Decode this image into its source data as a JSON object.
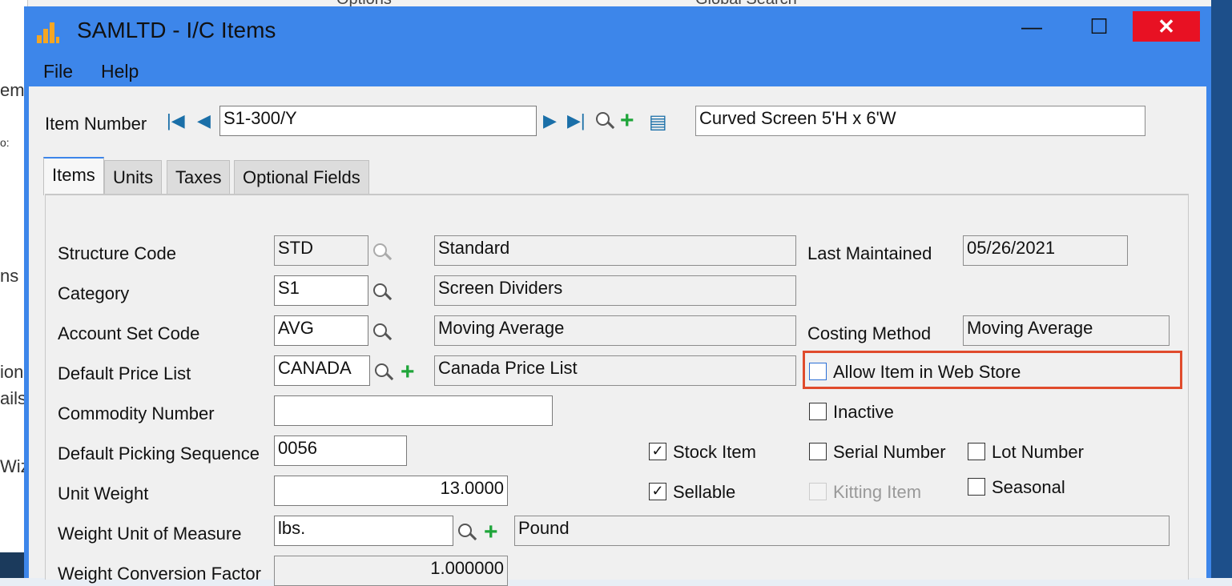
{
  "background": {
    "tab_options": "Options",
    "tab_global_search": "Global Search",
    "left_fragments": [
      "em",
      "o:",
      "ns",
      "ion",
      "ails",
      "Wiz"
    ]
  },
  "window": {
    "title": "SAMLTD - I/C Items",
    "controls": {
      "minimize": "—",
      "maximize": "☐",
      "close": "✕"
    },
    "menu": [
      "File",
      "Help"
    ]
  },
  "item": {
    "label": "Item Number",
    "number": "S1-300/Y",
    "description": "Curved Screen 5'H x 6'W"
  },
  "tabs": [
    "Items",
    "Units",
    "Taxes",
    "Optional Fields"
  ],
  "active_tab": "Items",
  "form": {
    "structure_code": {
      "label": "Structure Code",
      "value": "STD",
      "desc": "Standard"
    },
    "category": {
      "label": "Category",
      "value": "S1",
      "desc": "Screen Dividers"
    },
    "account_set": {
      "label": "Account Set Code",
      "value": "AVG",
      "desc": "Moving Average"
    },
    "price_list": {
      "label": "Default Price List",
      "value": "CANADA",
      "desc": "Canada Price List"
    },
    "commodity": {
      "label": "Commodity Number",
      "value": ""
    },
    "picking_seq": {
      "label": "Default Picking Sequence",
      "value": "0056"
    },
    "unit_weight": {
      "label": "Unit Weight",
      "value": "13.0000"
    },
    "weight_uom": {
      "label": "Weight Unit of Measure",
      "value": "lbs.",
      "desc": "Pound"
    },
    "weight_conv": {
      "label": "Weight Conversion Factor",
      "value": "1.000000"
    },
    "last_maintained": {
      "label": "Last Maintained",
      "value": "05/26/2021"
    },
    "costing_method": {
      "label": "Costing Method",
      "value": "Moving Average"
    }
  },
  "checkboxes": {
    "allow_web_store": {
      "label": "Allow Item in Web Store",
      "checked": false
    },
    "inactive": {
      "label": "Inactive",
      "checked": false
    },
    "stock_item": {
      "label": "Stock Item",
      "checked": true
    },
    "serial_number": {
      "label": "Serial Number",
      "checked": false
    },
    "lot_number": {
      "label": "Lot Number",
      "checked": false
    },
    "sellable": {
      "label": "Sellable",
      "checked": true
    },
    "kitting_item": {
      "label": "Kitting Item",
      "checked": false,
      "disabled": true
    },
    "seasonal": {
      "label": "Seasonal",
      "checked": false
    }
  },
  "colors": {
    "titlebar": "#3d86ea",
    "close": "#e81123",
    "highlight": "#e04b2c",
    "plus": "#1fa53a"
  }
}
